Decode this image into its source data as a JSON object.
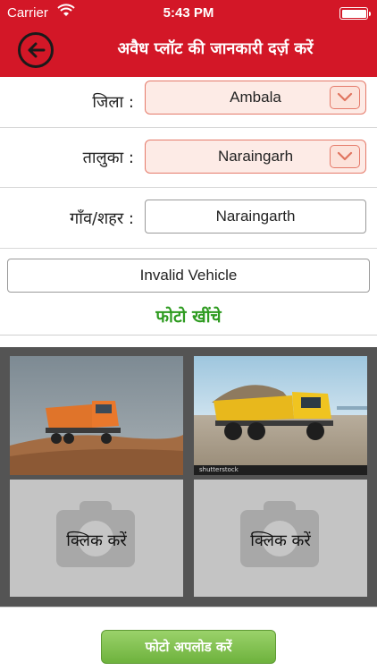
{
  "status_bar": {
    "carrier": "Carrier",
    "time": "5:43 PM"
  },
  "header": {
    "title": "अवैध प्लॉट की जानकारी दर्ज़ करें",
    "back_icon": "back-arrow-icon",
    "color": "#d31727"
  },
  "form": {
    "district": {
      "label": "जिला :",
      "value": "Ambala"
    },
    "taluka": {
      "label": "तालुका :",
      "value": "Naraingarh"
    },
    "village": {
      "label": "गाँव/शहर :",
      "value": "Naraingarth"
    },
    "vehicle": {
      "value": "Invalid Vehicle"
    }
  },
  "photo_section": {
    "take_photo_label": "फोटो खींचे",
    "slots": [
      {
        "state": "photo",
        "description_icon": "truck-photo"
      },
      {
        "state": "photo",
        "description_icon": "dump-truck-photo",
        "watermark": "shutterstock"
      },
      {
        "state": "empty",
        "label": "क्लिक करें",
        "icon": "camera-icon"
      },
      {
        "state": "empty",
        "label": "क्लिक करें",
        "icon": "camera-icon"
      }
    ]
  },
  "upload_button": {
    "label": "फोटो अपलोड करें",
    "color": "#7dbf4a"
  }
}
